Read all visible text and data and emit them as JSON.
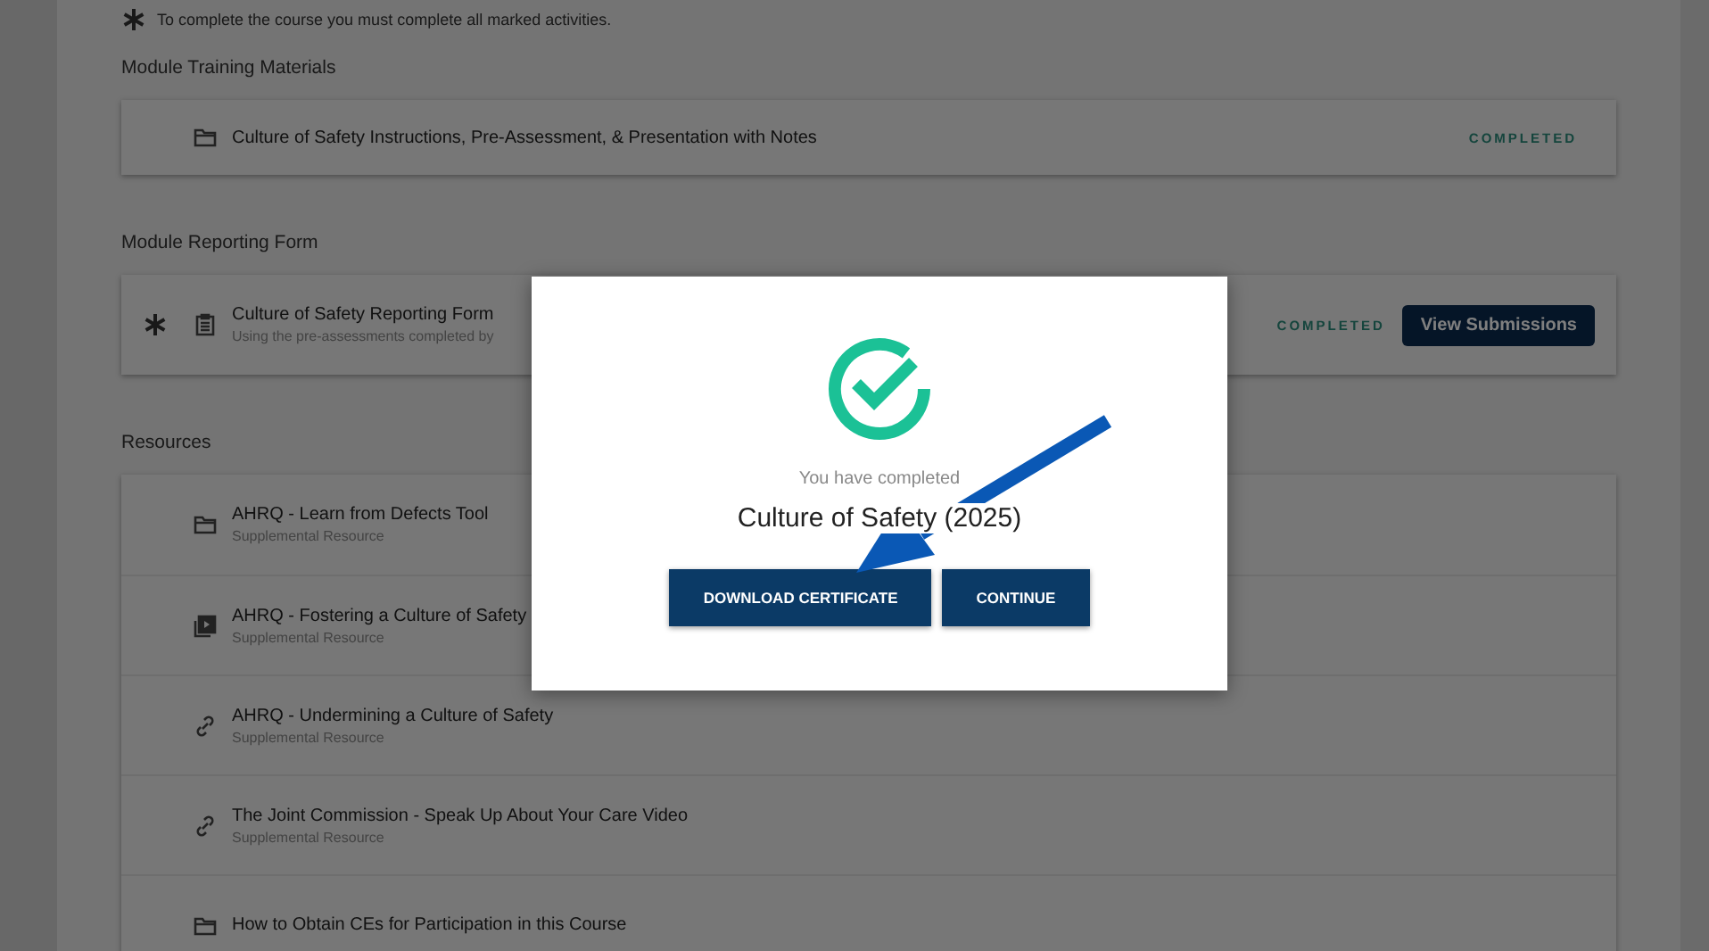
{
  "note": "To complete the course you must complete all marked activities.",
  "sections": [
    {
      "title": "Module Training Materials",
      "items": [
        {
          "kind": "folder",
          "required": false,
          "title": "Culture of Safety Instructions, Pre-Assessment, & Presentation with Notes",
          "status": "COMPLETED"
        }
      ]
    },
    {
      "title": "Module Reporting Form",
      "items": [
        {
          "kind": "form",
          "required": true,
          "title": "Culture of Safety Reporting Form",
          "subtitle": "Using the pre-assessments completed by",
          "status": "COMPLETED",
          "button": "View Submissions"
        }
      ]
    },
    {
      "title": "Resources",
      "items": [
        {
          "kind": "folder",
          "required": false,
          "title": "AHRQ - Learn from Defects Tool",
          "subtitle": "Supplemental Resource"
        },
        {
          "kind": "video",
          "required": false,
          "title": "AHRQ - Fostering a Culture of Safety",
          "subtitle": "Supplemental Resource"
        },
        {
          "kind": "link",
          "required": false,
          "title": "AHRQ - Undermining a Culture of Safety",
          "subtitle": "Supplemental Resource"
        },
        {
          "kind": "link",
          "required": false,
          "title": "The Joint Commission - Speak Up About Your Care Video",
          "subtitle": "Supplemental Resource"
        },
        {
          "kind": "folder",
          "required": false,
          "title": "How to Obtain CEs for Participation in this Course"
        }
      ]
    }
  ],
  "modal": {
    "subtitle": "You have completed",
    "title": "Culture of Safety (2025)",
    "buttons": [
      "DOWNLOAD CERTIFICATE",
      "CONTINUE"
    ]
  }
}
